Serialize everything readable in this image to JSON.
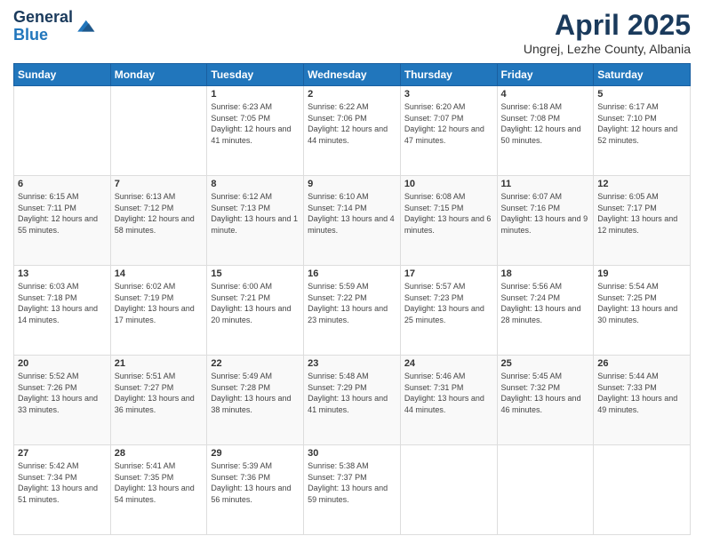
{
  "header": {
    "logo_line1": "General",
    "logo_line2": "Blue",
    "month_title": "April 2025",
    "location": "Ungrej, Lezhe County, Albania"
  },
  "days_of_week": [
    "Sunday",
    "Monday",
    "Tuesday",
    "Wednesday",
    "Thursday",
    "Friday",
    "Saturday"
  ],
  "weeks": [
    [
      {
        "day": "",
        "info": ""
      },
      {
        "day": "",
        "info": ""
      },
      {
        "day": "1",
        "info": "Sunrise: 6:23 AM\nSunset: 7:05 PM\nDaylight: 12 hours and 41 minutes."
      },
      {
        "day": "2",
        "info": "Sunrise: 6:22 AM\nSunset: 7:06 PM\nDaylight: 12 hours and 44 minutes."
      },
      {
        "day": "3",
        "info": "Sunrise: 6:20 AM\nSunset: 7:07 PM\nDaylight: 12 hours and 47 minutes."
      },
      {
        "day": "4",
        "info": "Sunrise: 6:18 AM\nSunset: 7:08 PM\nDaylight: 12 hours and 50 minutes."
      },
      {
        "day": "5",
        "info": "Sunrise: 6:17 AM\nSunset: 7:10 PM\nDaylight: 12 hours and 52 minutes."
      }
    ],
    [
      {
        "day": "6",
        "info": "Sunrise: 6:15 AM\nSunset: 7:11 PM\nDaylight: 12 hours and 55 minutes."
      },
      {
        "day": "7",
        "info": "Sunrise: 6:13 AM\nSunset: 7:12 PM\nDaylight: 12 hours and 58 minutes."
      },
      {
        "day": "8",
        "info": "Sunrise: 6:12 AM\nSunset: 7:13 PM\nDaylight: 13 hours and 1 minute."
      },
      {
        "day": "9",
        "info": "Sunrise: 6:10 AM\nSunset: 7:14 PM\nDaylight: 13 hours and 4 minutes."
      },
      {
        "day": "10",
        "info": "Sunrise: 6:08 AM\nSunset: 7:15 PM\nDaylight: 13 hours and 6 minutes."
      },
      {
        "day": "11",
        "info": "Sunrise: 6:07 AM\nSunset: 7:16 PM\nDaylight: 13 hours and 9 minutes."
      },
      {
        "day": "12",
        "info": "Sunrise: 6:05 AM\nSunset: 7:17 PM\nDaylight: 13 hours and 12 minutes."
      }
    ],
    [
      {
        "day": "13",
        "info": "Sunrise: 6:03 AM\nSunset: 7:18 PM\nDaylight: 13 hours and 14 minutes."
      },
      {
        "day": "14",
        "info": "Sunrise: 6:02 AM\nSunset: 7:19 PM\nDaylight: 13 hours and 17 minutes."
      },
      {
        "day": "15",
        "info": "Sunrise: 6:00 AM\nSunset: 7:21 PM\nDaylight: 13 hours and 20 minutes."
      },
      {
        "day": "16",
        "info": "Sunrise: 5:59 AM\nSunset: 7:22 PM\nDaylight: 13 hours and 23 minutes."
      },
      {
        "day": "17",
        "info": "Sunrise: 5:57 AM\nSunset: 7:23 PM\nDaylight: 13 hours and 25 minutes."
      },
      {
        "day": "18",
        "info": "Sunrise: 5:56 AM\nSunset: 7:24 PM\nDaylight: 13 hours and 28 minutes."
      },
      {
        "day": "19",
        "info": "Sunrise: 5:54 AM\nSunset: 7:25 PM\nDaylight: 13 hours and 30 minutes."
      }
    ],
    [
      {
        "day": "20",
        "info": "Sunrise: 5:52 AM\nSunset: 7:26 PM\nDaylight: 13 hours and 33 minutes."
      },
      {
        "day": "21",
        "info": "Sunrise: 5:51 AM\nSunset: 7:27 PM\nDaylight: 13 hours and 36 minutes."
      },
      {
        "day": "22",
        "info": "Sunrise: 5:49 AM\nSunset: 7:28 PM\nDaylight: 13 hours and 38 minutes."
      },
      {
        "day": "23",
        "info": "Sunrise: 5:48 AM\nSunset: 7:29 PM\nDaylight: 13 hours and 41 minutes."
      },
      {
        "day": "24",
        "info": "Sunrise: 5:46 AM\nSunset: 7:31 PM\nDaylight: 13 hours and 44 minutes."
      },
      {
        "day": "25",
        "info": "Sunrise: 5:45 AM\nSunset: 7:32 PM\nDaylight: 13 hours and 46 minutes."
      },
      {
        "day": "26",
        "info": "Sunrise: 5:44 AM\nSunset: 7:33 PM\nDaylight: 13 hours and 49 minutes."
      }
    ],
    [
      {
        "day": "27",
        "info": "Sunrise: 5:42 AM\nSunset: 7:34 PM\nDaylight: 13 hours and 51 minutes."
      },
      {
        "day": "28",
        "info": "Sunrise: 5:41 AM\nSunset: 7:35 PM\nDaylight: 13 hours and 54 minutes."
      },
      {
        "day": "29",
        "info": "Sunrise: 5:39 AM\nSunset: 7:36 PM\nDaylight: 13 hours and 56 minutes."
      },
      {
        "day": "30",
        "info": "Sunrise: 5:38 AM\nSunset: 7:37 PM\nDaylight: 13 hours and 59 minutes."
      },
      {
        "day": "",
        "info": ""
      },
      {
        "day": "",
        "info": ""
      },
      {
        "day": "",
        "info": ""
      }
    ]
  ]
}
